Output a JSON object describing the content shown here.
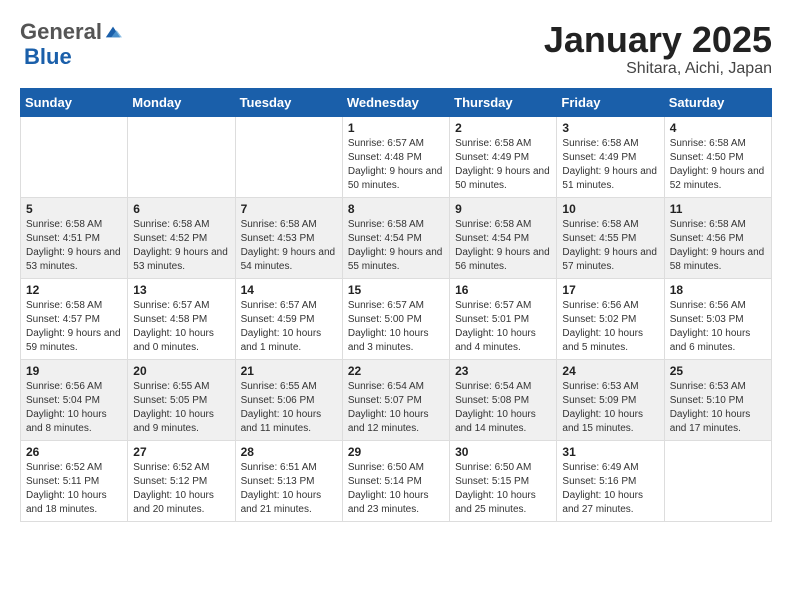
{
  "header": {
    "logo_general": "General",
    "logo_blue": "Blue",
    "title": "January 2025",
    "subtitle": "Shitara, Aichi, Japan"
  },
  "days_of_week": [
    "Sunday",
    "Monday",
    "Tuesday",
    "Wednesday",
    "Thursday",
    "Friday",
    "Saturday"
  ],
  "weeks": [
    [
      {
        "date": "",
        "info": ""
      },
      {
        "date": "",
        "info": ""
      },
      {
        "date": "",
        "info": ""
      },
      {
        "date": "1",
        "info": "Sunrise: 6:57 AM\nSunset: 4:48 PM\nDaylight: 9 hours\nand 50 minutes."
      },
      {
        "date": "2",
        "info": "Sunrise: 6:58 AM\nSunset: 4:49 PM\nDaylight: 9 hours\nand 50 minutes."
      },
      {
        "date": "3",
        "info": "Sunrise: 6:58 AM\nSunset: 4:49 PM\nDaylight: 9 hours\nand 51 minutes."
      },
      {
        "date": "4",
        "info": "Sunrise: 6:58 AM\nSunset: 4:50 PM\nDaylight: 9 hours\nand 52 minutes."
      }
    ],
    [
      {
        "date": "5",
        "info": "Sunrise: 6:58 AM\nSunset: 4:51 PM\nDaylight: 9 hours\nand 53 minutes."
      },
      {
        "date": "6",
        "info": "Sunrise: 6:58 AM\nSunset: 4:52 PM\nDaylight: 9 hours\nand 53 minutes."
      },
      {
        "date": "7",
        "info": "Sunrise: 6:58 AM\nSunset: 4:53 PM\nDaylight: 9 hours\nand 54 minutes."
      },
      {
        "date": "8",
        "info": "Sunrise: 6:58 AM\nSunset: 4:54 PM\nDaylight: 9 hours\nand 55 minutes."
      },
      {
        "date": "9",
        "info": "Sunrise: 6:58 AM\nSunset: 4:54 PM\nDaylight: 9 hours\nand 56 minutes."
      },
      {
        "date": "10",
        "info": "Sunrise: 6:58 AM\nSunset: 4:55 PM\nDaylight: 9 hours\nand 57 minutes."
      },
      {
        "date": "11",
        "info": "Sunrise: 6:58 AM\nSunset: 4:56 PM\nDaylight: 9 hours\nand 58 minutes."
      }
    ],
    [
      {
        "date": "12",
        "info": "Sunrise: 6:58 AM\nSunset: 4:57 PM\nDaylight: 9 hours\nand 59 minutes."
      },
      {
        "date": "13",
        "info": "Sunrise: 6:57 AM\nSunset: 4:58 PM\nDaylight: 10 hours\nand 0 minutes."
      },
      {
        "date": "14",
        "info": "Sunrise: 6:57 AM\nSunset: 4:59 PM\nDaylight: 10 hours\nand 1 minute."
      },
      {
        "date": "15",
        "info": "Sunrise: 6:57 AM\nSunset: 5:00 PM\nDaylight: 10 hours\nand 3 minutes."
      },
      {
        "date": "16",
        "info": "Sunrise: 6:57 AM\nSunset: 5:01 PM\nDaylight: 10 hours\nand 4 minutes."
      },
      {
        "date": "17",
        "info": "Sunrise: 6:56 AM\nSunset: 5:02 PM\nDaylight: 10 hours\nand 5 minutes."
      },
      {
        "date": "18",
        "info": "Sunrise: 6:56 AM\nSunset: 5:03 PM\nDaylight: 10 hours\nand 6 minutes."
      }
    ],
    [
      {
        "date": "19",
        "info": "Sunrise: 6:56 AM\nSunset: 5:04 PM\nDaylight: 10 hours\nand 8 minutes."
      },
      {
        "date": "20",
        "info": "Sunrise: 6:55 AM\nSunset: 5:05 PM\nDaylight: 10 hours\nand 9 minutes."
      },
      {
        "date": "21",
        "info": "Sunrise: 6:55 AM\nSunset: 5:06 PM\nDaylight: 10 hours\nand 11 minutes."
      },
      {
        "date": "22",
        "info": "Sunrise: 6:54 AM\nSunset: 5:07 PM\nDaylight: 10 hours\nand 12 minutes."
      },
      {
        "date": "23",
        "info": "Sunrise: 6:54 AM\nSunset: 5:08 PM\nDaylight: 10 hours\nand 14 minutes."
      },
      {
        "date": "24",
        "info": "Sunrise: 6:53 AM\nSunset: 5:09 PM\nDaylight: 10 hours\nand 15 minutes."
      },
      {
        "date": "25",
        "info": "Sunrise: 6:53 AM\nSunset: 5:10 PM\nDaylight: 10 hours\nand 17 minutes."
      }
    ],
    [
      {
        "date": "26",
        "info": "Sunrise: 6:52 AM\nSunset: 5:11 PM\nDaylight: 10 hours\nand 18 minutes."
      },
      {
        "date": "27",
        "info": "Sunrise: 6:52 AM\nSunset: 5:12 PM\nDaylight: 10 hours\nand 20 minutes."
      },
      {
        "date": "28",
        "info": "Sunrise: 6:51 AM\nSunset: 5:13 PM\nDaylight: 10 hours\nand 21 minutes."
      },
      {
        "date": "29",
        "info": "Sunrise: 6:50 AM\nSunset: 5:14 PM\nDaylight: 10 hours\nand 23 minutes."
      },
      {
        "date": "30",
        "info": "Sunrise: 6:50 AM\nSunset: 5:15 PM\nDaylight: 10 hours\nand 25 minutes."
      },
      {
        "date": "31",
        "info": "Sunrise: 6:49 AM\nSunset: 5:16 PM\nDaylight: 10 hours\nand 27 minutes."
      },
      {
        "date": "",
        "info": ""
      }
    ]
  ]
}
